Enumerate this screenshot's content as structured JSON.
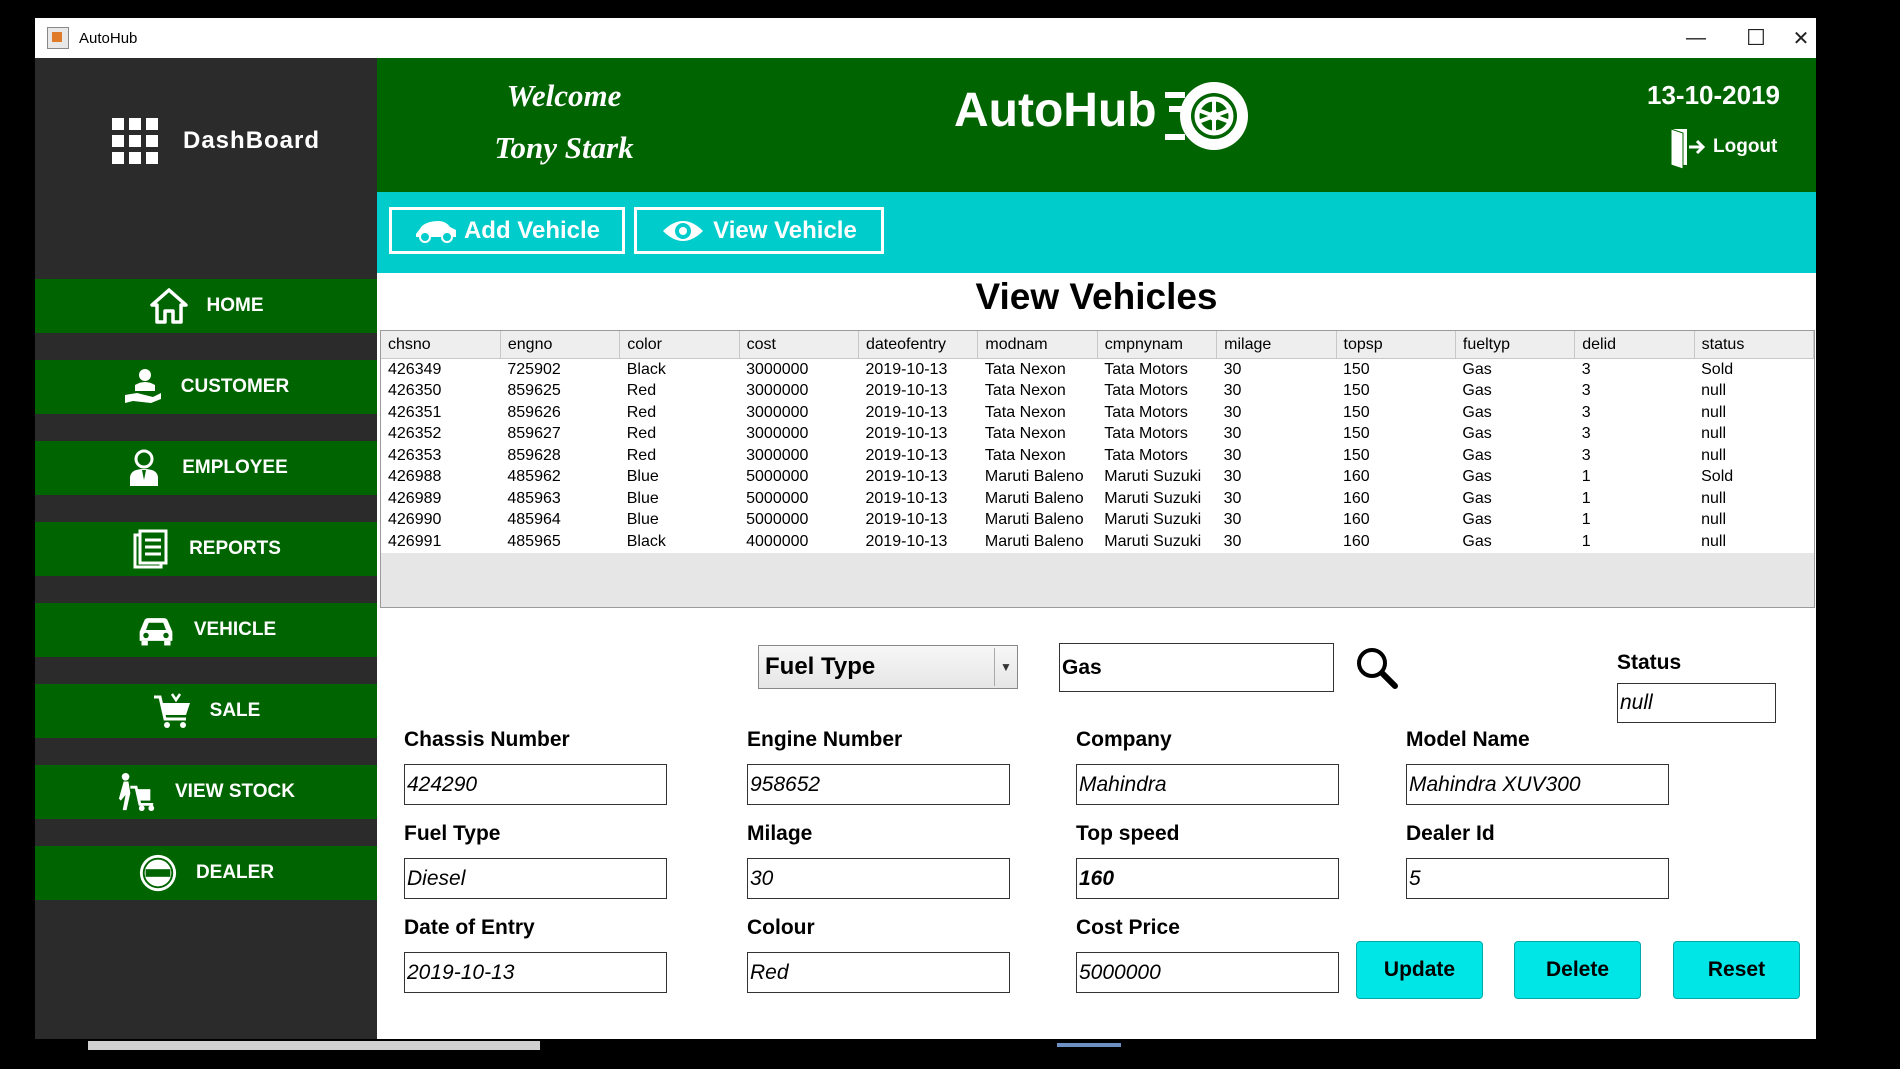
{
  "window": {
    "title": "AutoHub",
    "minimize": "—",
    "maximize": "☐",
    "close": "✕"
  },
  "sidebar": {
    "dashboard_label": "DashBoard",
    "items": [
      {
        "label": "HOME",
        "icon": "home-icon"
      },
      {
        "label": "CUSTOMER",
        "icon": "customer-icon"
      },
      {
        "label": "EMPLOYEE",
        "icon": "employee-icon"
      },
      {
        "label": "REPORTS",
        "icon": "reports-icon"
      },
      {
        "label": "VEHICLE",
        "icon": "car-icon"
      },
      {
        "label": "SALE",
        "icon": "cart-icon"
      },
      {
        "label": "VIEW STOCK",
        "icon": "stock-icon"
      },
      {
        "label": "DEALER",
        "icon": "dealer-icon"
      }
    ]
  },
  "header": {
    "welcome": "Welcome",
    "user": "Tony Stark",
    "brand": "AutoHub",
    "date": "13-10-2019",
    "logout": "Logout"
  },
  "toolbar": {
    "add_vehicle": "Add Vehicle",
    "view_vehicle": "View Vehicle"
  },
  "page_title": "View Vehicles",
  "table": {
    "columns": [
      "chsno",
      "engno",
      "color",
      "cost",
      "dateofentry",
      "modnam",
      "cmpnynam",
      "milage",
      "topsp",
      "fueltyp",
      "delid",
      "status"
    ],
    "rows": [
      [
        "426349",
        "725902",
        "Black",
        "3000000",
        "2019-10-13",
        "Tata Nexon",
        "Tata Motors",
        "30",
        "150",
        "Gas",
        "3",
        "Sold"
      ],
      [
        "426350",
        "859625",
        "Red",
        "3000000",
        "2019-10-13",
        "Tata Nexon",
        "Tata Motors",
        "30",
        "150",
        "Gas",
        "3",
        "null"
      ],
      [
        "426351",
        "859626",
        "Red",
        "3000000",
        "2019-10-13",
        "Tata Nexon",
        "Tata Motors",
        "30",
        "150",
        "Gas",
        "3",
        "null"
      ],
      [
        "426352",
        "859627",
        "Red",
        "3000000",
        "2019-10-13",
        "Tata Nexon",
        "Tata Motors",
        "30",
        "150",
        "Gas",
        "3",
        "null"
      ],
      [
        "426353",
        "859628",
        "Red",
        "3000000",
        "2019-10-13",
        "Tata Nexon",
        "Tata Motors",
        "30",
        "150",
        "Gas",
        "3",
        "null"
      ],
      [
        "426988",
        "485962",
        "Blue",
        "5000000",
        "2019-10-13",
        "Maruti Baleno",
        "Maruti Suzuki",
        "30",
        "160",
        "Gas",
        "1",
        "Sold"
      ],
      [
        "426989",
        "485963",
        "Blue",
        "5000000",
        "2019-10-13",
        "Maruti Baleno",
        "Maruti Suzuki",
        "30",
        "160",
        "Gas",
        "1",
        "null"
      ],
      [
        "426990",
        "485964",
        "Blue",
        "5000000",
        "2019-10-13",
        "Maruti Baleno",
        "Maruti Suzuki",
        "30",
        "160",
        "Gas",
        "1",
        "null"
      ],
      [
        "426991",
        "485965",
        "Black",
        "4000000",
        "2019-10-13",
        "Maruti Baleno",
        "Maruti Suzuki",
        "30",
        "160",
        "Gas",
        "1",
        "null"
      ]
    ]
  },
  "filter": {
    "selected": "Fuel Type",
    "search_value": "Gas"
  },
  "status": {
    "label": "Status",
    "value": "null"
  },
  "form": {
    "chassis_label": "Chassis Number",
    "chassis_value": "424290",
    "engine_label": "Engine Number",
    "engine_value": "958652",
    "company_label": "Company",
    "company_value": "Mahindra",
    "model_label": "Model Name",
    "model_value": "Mahindra XUV300",
    "fuel_label": "Fuel Type",
    "fuel_value": "Diesel",
    "milage_label": "Milage",
    "milage_value": "30",
    "topspeed_label": "Top speed",
    "topspeed_value": "160",
    "dealer_label": "Dealer Id",
    "dealer_value": "5",
    "date_label": "Date of Entry",
    "date_value": "2019-10-13",
    "colour_label": "Colour",
    "colour_value": "Red",
    "cost_label": "Cost Price",
    "cost_value": "5000000"
  },
  "actions": {
    "update": "Update",
    "delete": "Delete",
    "reset": "Reset"
  },
  "colors": {
    "green": "#006400",
    "cyan": "#00cccc",
    "sidebar": "#2b2b2b",
    "button": "#00e5e5"
  }
}
